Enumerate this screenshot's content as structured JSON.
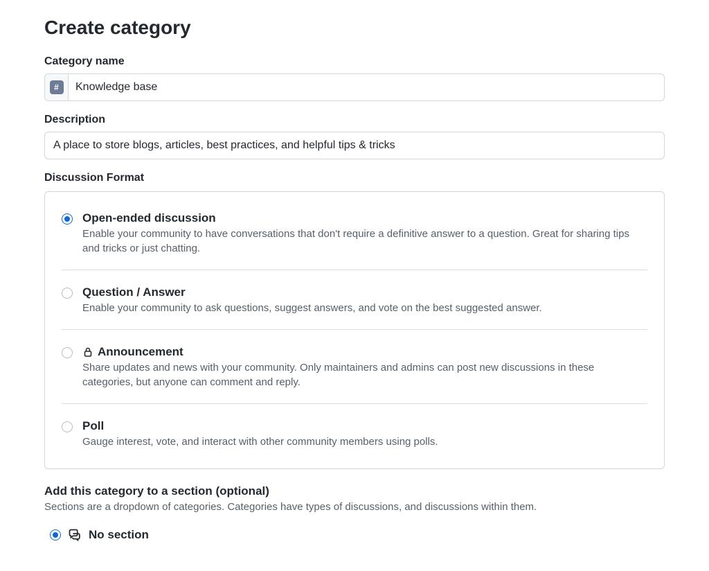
{
  "page": {
    "title": "Create category"
  },
  "name_field": {
    "label": "Category name",
    "value": "Knowledge base",
    "emoji_glyph": "#"
  },
  "description_field": {
    "label": "Description",
    "value": "A place to store blogs, articles, best practices, and helpful tips & tricks"
  },
  "format": {
    "label": "Discussion Format",
    "options": [
      {
        "title": "Open-ended discussion",
        "desc": "Enable your community to have conversations that don't require a definitive answer to a question. Great for sharing tips and tricks or just chatting.",
        "checked": true,
        "locked": false
      },
      {
        "title": "Question / Answer",
        "desc": "Enable your community to ask questions, suggest answers, and vote on the best suggested answer.",
        "checked": false,
        "locked": false
      },
      {
        "title": "Announcement",
        "desc": "Share updates and news with your community. Only maintainers and admins can post new discussions in these categories, but anyone can comment and reply.",
        "checked": false,
        "locked": true
      },
      {
        "title": "Poll",
        "desc": "Gauge interest, vote, and interact with other community members using polls.",
        "checked": false,
        "locked": false
      }
    ]
  },
  "section": {
    "title": "Add this category to a section (optional)",
    "sub": "Sections are a dropdown of categories. Categories have types of discussions, and discussions within them.",
    "option_label": "No section",
    "option_checked": true
  }
}
